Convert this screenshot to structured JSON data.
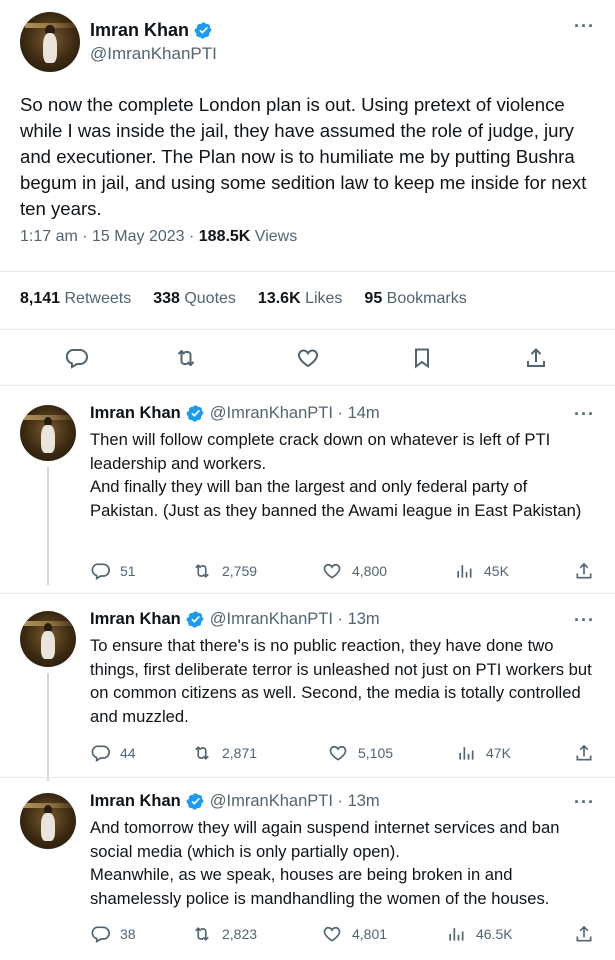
{
  "main_tweet": {
    "author_name": "Imran Khan",
    "author_handle": "@ImranKhanPTI",
    "more_label": "···",
    "text": "So now the complete London plan is out.  Using pretext of violence while I was inside the jail, they have assumed the role of judge, jury and executioner. The Plan now is to humiliate me by putting Bushra begum in jail, and using some sedition law to keep me inside for next ten years.",
    "time": "1:17 am · 15 May 2023 · ",
    "views_count": "188.5K",
    "views_label": " Views",
    "stats": {
      "retweets_count": "8,141",
      "retweets_label": " Retweets",
      "quotes_count": "338",
      "quotes_label": " Quotes",
      "likes_count": "13.6K",
      "likes_label": " Likes",
      "bookmarks_count": "95",
      "bookmarks_label": " Bookmarks"
    },
    "action_icons": [
      "reply-icon",
      "retweet-icon",
      "like-icon",
      "bookmark-icon",
      "share-icon"
    ]
  },
  "replies": [
    {
      "author_name": "Imran Khan",
      "author_handle": "@ImranKhanPTI · 14m",
      "more_label": "···",
      "text": "Then will follow complete crack down on whatever is left of PTI leadership and workers.\nAnd finally they will ban the largest and only federal party of Pakistan. (Just as they banned the Awami league in East Pakistan)",
      "replies": "51",
      "retweets": "2,759",
      "likes": "4,800",
      "views": "45K"
    },
    {
      "author_name": "Imran Khan",
      "author_handle": "@ImranKhanPTI · 13m",
      "more_label": "···",
      "text": "To ensure that there's is no public reaction, they have done two things, first deliberate terror is unleashed not just on PTI workers but on common citizens as well. Second, the media is totally controlled and muzzled.",
      "replies": "44",
      "retweets": "2,871",
      "likes": "5,105",
      "views": "47K"
    },
    {
      "author_name": "Imran Khan",
      "author_handle": "@ImranKhanPTI · 13m",
      "more_label": "···",
      "text": "And tomorrow they will again suspend internet services and ban social media (which is only partially open).\nMeanwhile, as we speak, houses are being broken in and shamelessly police is mandhandling the women of the houses.",
      "replies": "38",
      "retweets": "2,823",
      "likes": "4,801",
      "views": "46.5K"
    }
  ],
  "colors": {
    "verified": "#1d9bf0",
    "text_primary": "#0f1419",
    "text_secondary": "#536471",
    "divider": "#e6e9eb",
    "thread_line": "#cfd9de"
  }
}
